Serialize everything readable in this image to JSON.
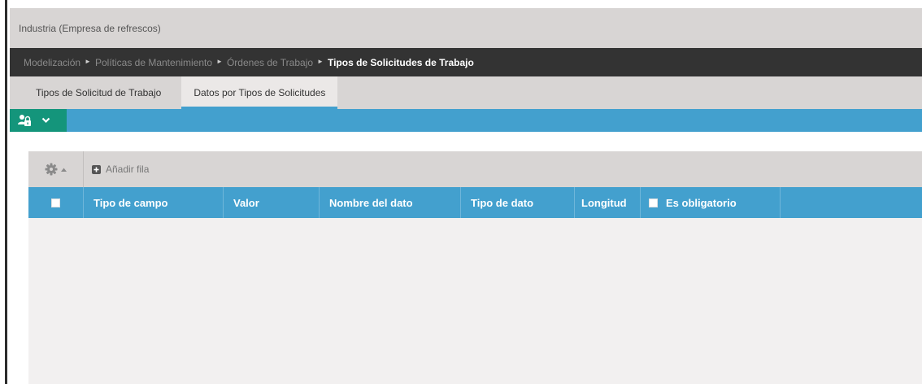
{
  "title_bar": {
    "title": "Industria (Empresa de refrescos)"
  },
  "breadcrumb": {
    "items": [
      "Modelización",
      "Políticas de Mantenimiento",
      "Órdenes de Trabajo"
    ],
    "separator": "►",
    "current": "Tipos de Solicitudes de Trabajo"
  },
  "tabs": [
    {
      "label": "Tipos de Solicitud de Trabajo",
      "active": false
    },
    {
      "label": "Datos por Tipos de Solicitudes",
      "active": true
    }
  ],
  "action_bar": {
    "icon": "shared-lock-icon",
    "dropdown_icon": "chevron-down-icon"
  },
  "grid": {
    "toolbar": {
      "settings_icon": "gear-icon",
      "add_row_label": "Añadir fila",
      "add_row_icon": "plus-square-icon"
    },
    "columns": [
      "Tipo de campo",
      "Valor",
      "Nombre del dato",
      "Tipo de dato",
      "Longitud",
      "Es obligatorio"
    ],
    "rows": []
  },
  "colors": {
    "accent_blue": "#43a0ce",
    "action_green": "#14957b",
    "breadcrumb_bg": "#333333",
    "panel_gray": "#d8d5d4"
  }
}
